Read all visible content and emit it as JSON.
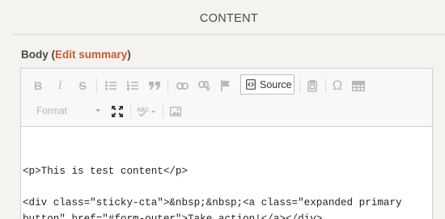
{
  "section": {
    "title": "CONTENT"
  },
  "field": {
    "label": "Body",
    "open_paren": " (",
    "link": "Edit summary",
    "close_paren": ")"
  },
  "toolbar": {
    "bold": "B",
    "italic": "I",
    "strike": "S",
    "source_label": "Source",
    "format_label": "Format"
  },
  "editor": {
    "lines": [
      "<p>This is test content</p>",
      "",
      "<div class=\"sticky-cta\">&nbsp;&nbsp;<a class=\"expanded primary button\" href=\"#form-outer\">Take action!</a></div>"
    ]
  },
  "colors": {
    "link": "#c75b2a",
    "disabled_icon": "#b8b8b8"
  }
}
